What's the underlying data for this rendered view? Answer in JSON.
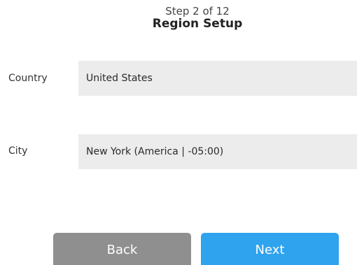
{
  "header": {
    "step": "Step 2 of 12",
    "title": "Region Setup"
  },
  "fields": {
    "country": {
      "label": "Country",
      "value": "United States"
    },
    "city": {
      "label": "City",
      "value": "New York (America | -05:00)"
    }
  },
  "buttons": {
    "back": "Back",
    "next": "Next"
  },
  "colors": {
    "back_button": "#8f8f8f",
    "next_button": "#2fa3ee",
    "field_background": "#ececec"
  }
}
